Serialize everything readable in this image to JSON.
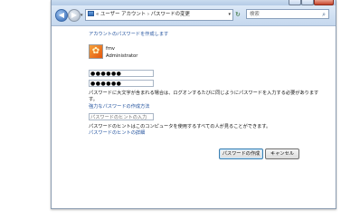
{
  "toolbar": {
    "back_glyph": "◀",
    "forward_glyph": "▶",
    "history_glyph": "▾",
    "address_chevron": "«",
    "address_path": "« ユーザー アカウント › パスワードの変更",
    "address_dropdown": "▾",
    "refresh_glyph": "↻",
    "search_placeholder": "検索",
    "search_icon": "⌕"
  },
  "main": {
    "page_title": "アカウントのパスワードを作成します",
    "user": {
      "name": "fmv",
      "role": "Administrator",
      "avatar_glyph": "✿"
    },
    "new_password_value": "●●●●●●",
    "confirm_password_value": "●●●●●●",
    "info_line1": "パスワードに大文字が含まれる場合は、ログオンするたびに同じようにパスワードを入力する必要があります",
    "info_line2": "す。",
    "strong_password_link": "強力なパスワードの作成方法",
    "hint_placeholder": "パスワードのヒントの入力",
    "hint_description": "パスワードのヒントはこのコンピュータを使用するすべての人が見ることができます。",
    "hint_link": "パスワードのヒントの詳細",
    "create_button": "パスワードの作成",
    "cancel_button": "キャンセル"
  },
  "colors": {
    "link": "#1e4f9c",
    "titlebar": "#c9dbef",
    "close_button": "#c6452c"
  }
}
